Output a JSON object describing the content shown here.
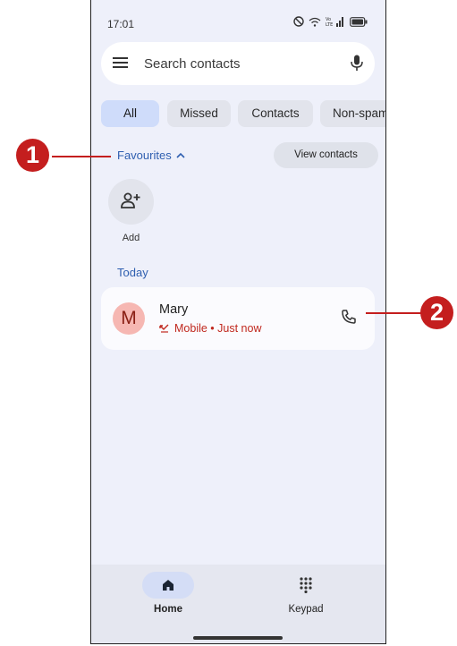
{
  "status_bar": {
    "time": "17:01"
  },
  "search": {
    "placeholder": "Search contacts"
  },
  "filters": [
    {
      "label": "All",
      "active": true
    },
    {
      "label": "Missed"
    },
    {
      "label": "Contacts"
    },
    {
      "label": "Non-spam"
    }
  ],
  "favourites": {
    "title": "Favourites",
    "view_contacts": "View contacts",
    "add_label": "Add"
  },
  "recents": {
    "section": "Today",
    "items": [
      {
        "initial": "M",
        "name": "Mary",
        "detail": "Mobile • Just now",
        "missed_color": "#c0281e",
        "avatar_color": "#f6b7b2"
      }
    ]
  },
  "bottom_nav": [
    {
      "label": "Home",
      "icon": "home-icon",
      "active": true
    },
    {
      "label": "Keypad",
      "icon": "dialpad-icon"
    }
  ],
  "callouts": [
    {
      "number": "1"
    },
    {
      "number": "2"
    }
  ],
  "colors": {
    "accent": "#2f5fb0",
    "missed": "#c0281e",
    "callout": "#c41e1e",
    "background": "#eef0fa"
  }
}
